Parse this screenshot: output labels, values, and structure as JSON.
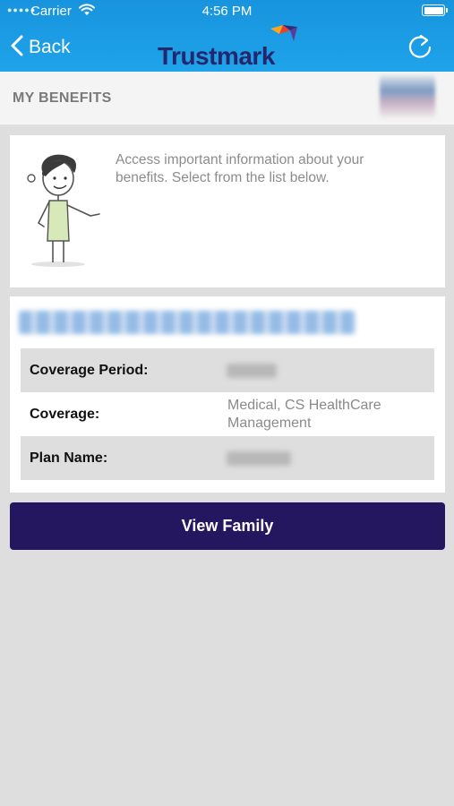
{
  "status_bar": {
    "carrier": "Carrier",
    "time": "4:56 PM"
  },
  "nav": {
    "back_label": "Back",
    "logo_text": "Trustmark",
    "back_icon": "chevron-left-icon",
    "refresh_icon": "refresh-icon"
  },
  "subheader": {
    "title": "MY BENEFITS"
  },
  "intro": {
    "text": "Access important information about your benefits. Select from the list below."
  },
  "details": {
    "rows": [
      {
        "label": "Coverage Period:",
        "value": ""
      },
      {
        "label": "Coverage:",
        "value": "Medical, CS HealthCare Management"
      },
      {
        "label": "Plan Name:",
        "value": ""
      }
    ]
  },
  "actions": {
    "view_family_label": "View Family"
  },
  "colors": {
    "header": "#1fa3ea",
    "button": "#24175f",
    "logo_text": "#25276d"
  }
}
